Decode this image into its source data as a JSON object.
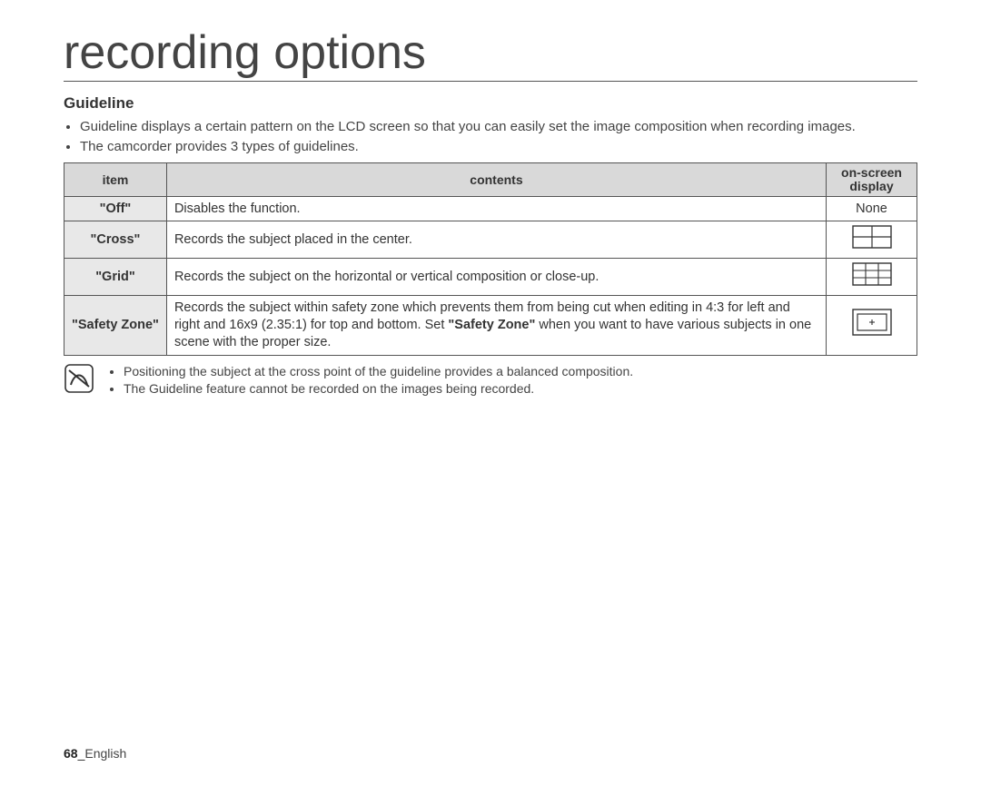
{
  "page_title": "recording options",
  "section": {
    "heading": "Guideline",
    "intro": [
      "Guideline displays a certain pattern on the LCD screen so that you can easily set the image composition when recording images.",
      "The camcorder provides 3 types of guidelines."
    ]
  },
  "table": {
    "headers": {
      "item": "item",
      "contents": "contents",
      "osd": "on-screen display"
    },
    "rows": {
      "off": {
        "item": "\"Off\"",
        "contents": "Disables the function.",
        "osd_text": "None"
      },
      "cross": {
        "item": "\"Cross\"",
        "contents": "Records the subject placed in the center."
      },
      "grid": {
        "item": "\"Grid\"",
        "contents": "Records the subject on the horizontal or vertical composition or close-up."
      },
      "safety": {
        "item": "\"Safety Zone\"",
        "contents_pre": "Records the subject within safety zone which prevents them from being cut when editing in 4:3 for left and right and 16x9 (2.35:1) for top and bottom. Set ",
        "contents_bold": "\"Safety Zone\"",
        "contents_post": " when you want to have various subjects in one scene with the proper size."
      }
    }
  },
  "notes": [
    "Positioning the subject at the cross point of the guideline provides a balanced composition.",
    "The Guideline feature cannot be recorded on the images being recorded."
  ],
  "footer": {
    "page_number": "68",
    "sep": "_",
    "lang": "English"
  }
}
